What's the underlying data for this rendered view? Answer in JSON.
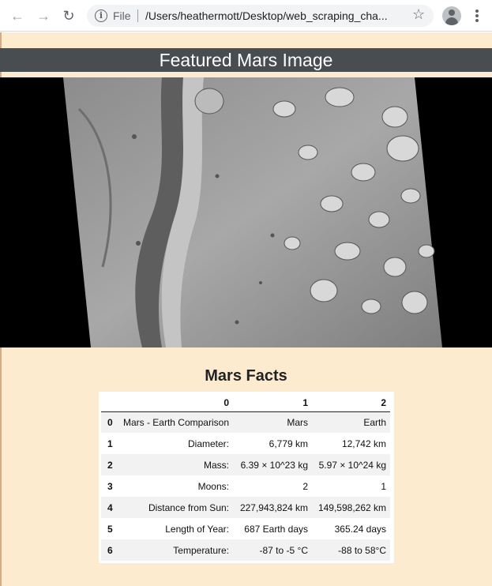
{
  "browser": {
    "file_label": "File",
    "url": "/Users/heathermott/Desktop/web_scraping_cha...",
    "back_icon": "arrow-left-icon",
    "forward_icon": "arrow-right-icon",
    "reload_icon": "reload-icon",
    "info_icon": "info-icon",
    "star_icon": "star-icon",
    "avatar_icon": "account-icon",
    "menu_icon": "more-vert-icon"
  },
  "page": {
    "featured_title": "Featured Mars Image",
    "facts_title": "Mars Facts",
    "background_color": "#fdebd0",
    "title_bar_color": "#484d52"
  },
  "facts_table": {
    "headers": [
      "",
      "0",
      "1",
      "2"
    ],
    "rows": [
      {
        "index": "0",
        "c0": "Mars - Earth Comparison",
        "c1": "Mars",
        "c2": "Earth"
      },
      {
        "index": "1",
        "c0": "Diameter:",
        "c1": "6,779 km",
        "c2": "12,742 km"
      },
      {
        "index": "2",
        "c0": "Mass:",
        "c1": "6.39 × 10^23 kg",
        "c2": "5.97 × 10^24 kg"
      },
      {
        "index": "3",
        "c0": "Moons:",
        "c1": "2",
        "c2": "1"
      },
      {
        "index": "4",
        "c0": "Distance from Sun:",
        "c1": "227,943,824 km",
        "c2": "149,598,262 km"
      },
      {
        "index": "5",
        "c0": "Length of Year:",
        "c1": "687 Earth days",
        "c2": "365.24 days"
      },
      {
        "index": "6",
        "c0": "Temperature:",
        "c1": "-87 to -5 °C",
        "c2": "-88 to 58°C"
      }
    ]
  }
}
